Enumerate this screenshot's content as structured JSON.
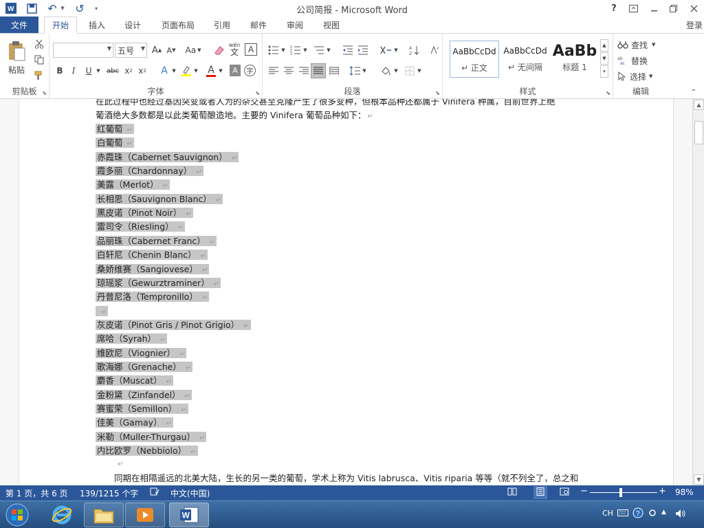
{
  "window": {
    "title": "公司简报 - Microsoft Word",
    "help": "?",
    "login": "登录"
  },
  "tabs": {
    "file": "文件",
    "items": [
      "开始",
      "插入",
      "设计",
      "页面布局",
      "引用",
      "邮件",
      "审阅",
      "视图"
    ],
    "active": "开始"
  },
  "ribbon": {
    "clipboard": {
      "label": "剪贴板",
      "paste": "粘贴"
    },
    "font": {
      "label": "字体",
      "font_name": "",
      "font_size": "五号",
      "grow": "A",
      "shrink": "A",
      "case": "Aa",
      "pinyin": "wén",
      "pinyin_char": "文",
      "charborder": "A",
      "bold": "B",
      "italic": "I",
      "underline": "U",
      "strike": "abc",
      "sub": "x",
      "sup": "x",
      "effect": "A",
      "color": "A",
      "shade": "A",
      "enclose": "字"
    },
    "paragraph": {
      "label": "段落"
    },
    "styles": {
      "label": "样式",
      "items": [
        {
          "sample": "AaBbCcDd",
          "name": "正文"
        },
        {
          "sample": "AaBbCcDd",
          "name": "无间隔"
        },
        {
          "sample": "AaBb",
          "name": "标题 1"
        }
      ]
    },
    "editing": {
      "label": "编辑",
      "find": "查找",
      "replace": "替换",
      "select": "选择"
    }
  },
  "document": {
    "intro_line1": "在此过程中也经过基因突变或者人为的杂交甚至克隆产生了很多变种，但根本品种还都属于 Vinifera 种属，目前世界上绝",
    "intro_line2": "葡酒绝大多数都是以此类葡萄酿造地。主要的 Vinifera 葡萄品种如下：",
    "varieties": [
      "红葡萄",
      "白葡萄",
      "赤霞珠（Cabernet Sauvignon）",
      "霞多丽（Chardonnay）",
      "美露（Merlot）",
      "长相思（Sauvignon Blanc）",
      "黑皮诺（Pinot Noir）",
      "雷司令（Riesling）",
      "品丽珠（Cabernet Franc）",
      "白轩尼（Chenin Blanc）",
      "桑娇维赛（Sangiovese）",
      "琼瑶浆（Gewurztraminer）",
      "丹普尼洛（Tempronillo）",
      "",
      "灰皮诺（Pinot Gris / Pinot Grigio）",
      "席哈（Syrah）",
      "维欧尼（Viognier）",
      "歌海娜（Grenache）",
      "麝香（Muscat）",
      "金粉黛（Zinfandel）",
      "赛蜜荣（Semillon）",
      "佳美（Gamay）",
      "米勒（Muller-Thurgau）",
      "内比欧罗（Nebbiolo）"
    ],
    "para2": "同期在相隔遥远的北美大陆，生长的另一类的葡萄，学术上称为 Vitis labrusca、Vitis riparia 等等（就不列全了，总之和",
    "para_mark": "↵"
  },
  "status": {
    "page": "第 1 页，共 6 页",
    "words": "139/1215 个字",
    "language": "中文(中国)",
    "zoom": "98%",
    "zoom_minus": "−",
    "zoom_plus": "+"
  },
  "taskbar": {
    "ime": "CH"
  },
  "colors": {
    "accent": "#2b579a",
    "highlight": "#c6c6c6"
  }
}
